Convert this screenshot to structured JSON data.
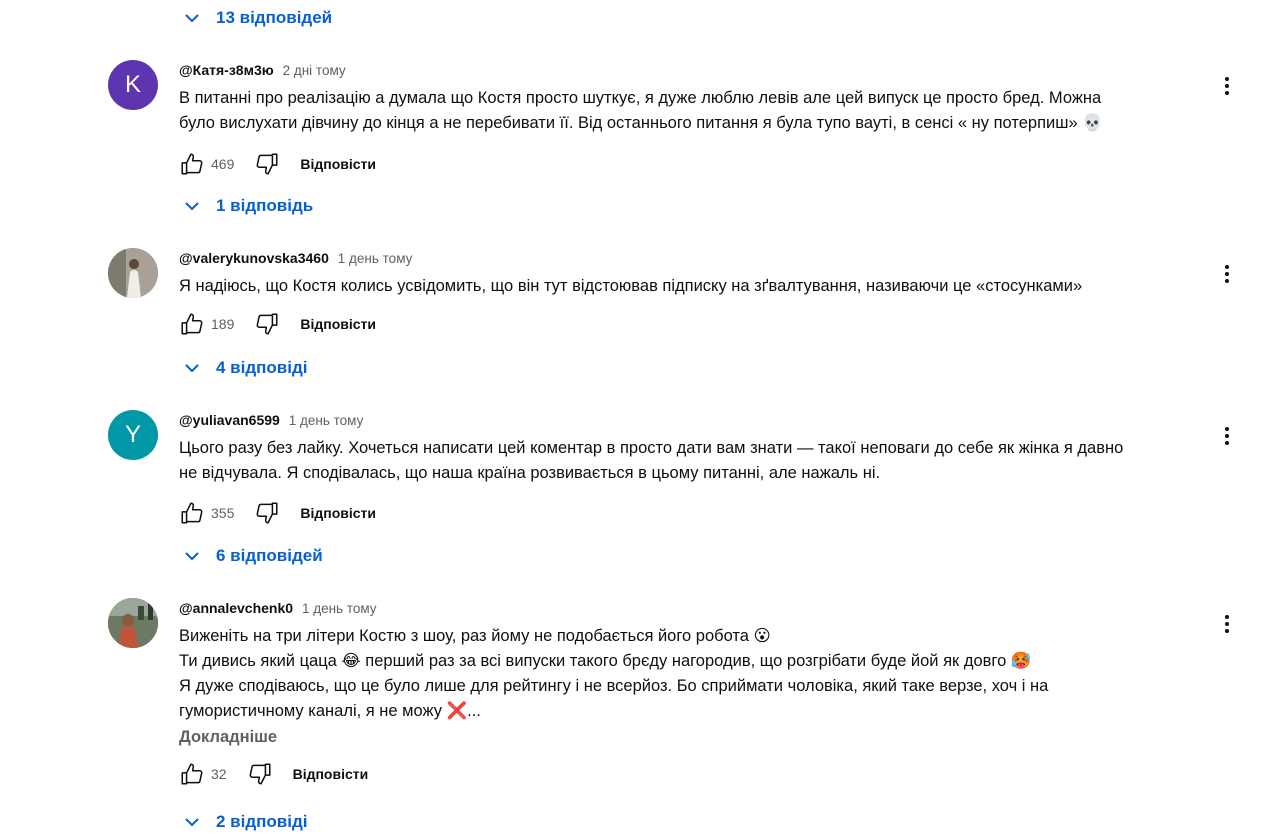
{
  "top_replies": {
    "label": "13 відповідей"
  },
  "comments": [
    {
      "author": "@Катя-з8м3ю",
      "time": "2 дні тому",
      "avatar_letter": "K",
      "avatar_color": "#5e35b1",
      "lines": [
        "В питанні про реалізацію а думала що Костя просто шуткує, я дуже люблю левів але цей випуск це просто бред. Можна",
        "було вислухати дівчину до кінця а не перебивати її. Від останнього питання я була тупо вауті, в сенсі « ну потерпиш» 💀"
      ],
      "likes": "469",
      "reply_label": "Відповісти",
      "replies_label": "1 відповідь"
    },
    {
      "author": "@valerykunovska3460",
      "time": "1 день тому",
      "avatar_letter": "",
      "avatar_color": "#b7a99a",
      "lines": [
        "Я надіюсь, що Костя колись усвідомить, що він тут відстоював підписку на зґвалтування, називаючи це «стосунками»"
      ],
      "likes": "189",
      "reply_label": "Відповісти",
      "replies_label": "4 відповіді"
    },
    {
      "author": "@yuliavan6599",
      "time": "1 день тому",
      "avatar_letter": "Y",
      "avatar_color": "#0097a7",
      "lines": [
        "Цього разу без лайку. Хочеться написати цей коментар в просто дати вам знати — такої неповаги до себе як жінка я давно",
        "не відчувала. Я сподівалась, що наша країна розвивається в цьому питанні, але нажаль ні."
      ],
      "likes": "355",
      "reply_label": "Відповісти",
      "replies_label": "6 відповідей"
    },
    {
      "author": "@annalevchenk0",
      "time": "1 день тому",
      "avatar_letter": "",
      "avatar_color": "#4a5a48",
      "lines": [
        "Виженіть на три літери Костю з шоу, раз йому не подобається його робота 😮",
        "Ти дивись який цаца 😂 перший раз за всі випуски такого брєду нагородив, що розгрібати буде йой як довго 🥵",
        "Я дуже сподіваюсь, що це було лише для рейтингу і не  всерйоз. Бо сприймати чоловіка, який таке верзе, хоч і на",
        "гумористичному каналі, я не можу ❌..."
      ],
      "more_label": "Докладніше",
      "likes": "32",
      "reply_label": "Відповісти",
      "replies_label": "2 відповіді"
    }
  ]
}
